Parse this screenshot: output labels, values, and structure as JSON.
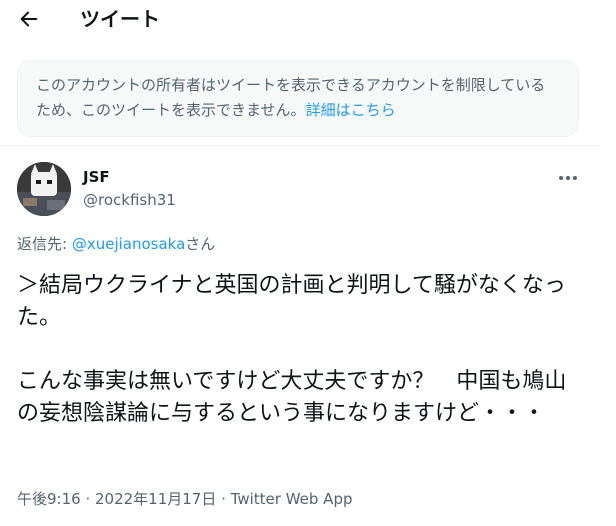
{
  "header": {
    "title": "ツイート"
  },
  "notice": {
    "text": "このアカウントの所有者はツイートを表示できるアカウントを制限しているため、このツイートを表示できません。",
    "link": "詳細はこちら"
  },
  "author": {
    "name": "JSF",
    "handle": "@rockfish31"
  },
  "reply": {
    "prefix": "返信先: ",
    "mention": "@xuejianosaka",
    "suffix": "さん"
  },
  "tweet": {
    "text": "＞結局ウクライナと英国の計画と判明して騒がなくなった。\n\nこんな事実は無いですけど大丈夫ですか？　中国も鳩山の妄想陰謀論に与するという事になりますけど・・・"
  },
  "meta": {
    "time": "午後9:16",
    "sep1": " · ",
    "date": "2022年11月17日",
    "sep2": " · ",
    "source": "Twitter Web App"
  },
  "colors": {
    "accent": "#1d9bf0",
    "secondary_text": "#536471",
    "notice_bg": "#f7f9f9"
  },
  "icons": {
    "back": "arrow-left-icon",
    "more": "more-horizontal-icon"
  }
}
